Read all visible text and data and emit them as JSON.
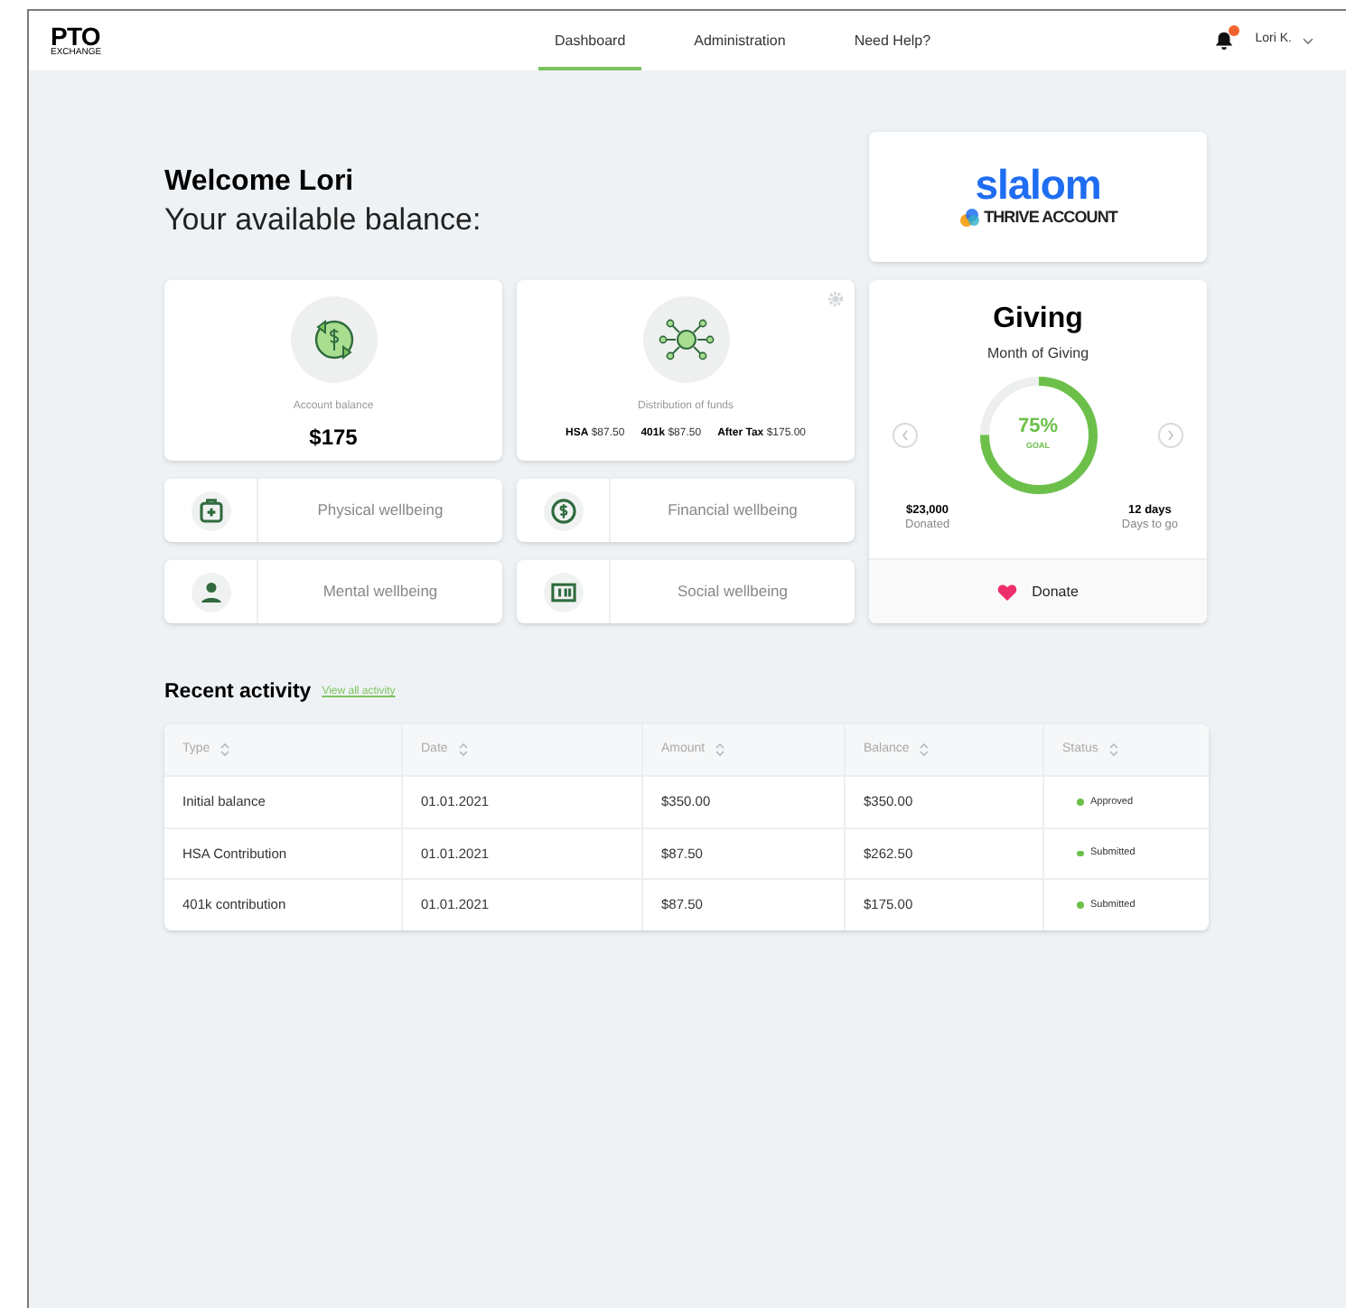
{
  "header": {
    "logo": {
      "title": "PTO",
      "subtitle": "EXCHANGE"
    },
    "nav": [
      {
        "label": "Dashboard",
        "selected": true
      },
      {
        "label": "Administration",
        "selected": false
      },
      {
        "label": "Need Help?",
        "selected": false
      }
    ],
    "notifications": {
      "unread": true
    },
    "user": "Lori K."
  },
  "welcome": {
    "title": "Welcome Lori",
    "subtitle": "Your available balance:"
  },
  "brand": {
    "name": "slalom",
    "account": "THRIVE ACCOUNT"
  },
  "account_card": {
    "label": "Account balance",
    "value": "$175"
  },
  "distribution_card": {
    "label": "Distribution of funds",
    "items": [
      {
        "name": "HSA",
        "value": "$87.50"
      },
      {
        "name": "401k",
        "value": "$87.50"
      },
      {
        "name": "After Tax",
        "value": "$175.00"
      }
    ]
  },
  "wellbeing": [
    {
      "kind": "physical",
      "label": "Physical wellbeing"
    },
    {
      "kind": "financial",
      "label": "Financial wellbeing"
    },
    {
      "kind": "mental",
      "label": "Mental wellbeing"
    },
    {
      "kind": "social",
      "label": "Social wellbeing"
    }
  ],
  "giving": {
    "title": "Giving",
    "subtitle": "Month of Giving",
    "level": 0.75,
    "percent": "75%",
    "goal_label": "GOAL",
    "donated": "$23,000",
    "donated_label": "Donated",
    "days": "12 days",
    "days_label": "Days to go",
    "donate_button": "Donate"
  },
  "recent_activity": {
    "title": "Recent activity",
    "link": "View all activity",
    "columns": [
      "Type",
      "Date",
      "Amount",
      "Balance",
      "Status"
    ],
    "rows": [
      {
        "type": "Initial balance",
        "date": "01.01.2021",
        "amount": "$350.00",
        "balance": "$350.00",
        "status": "Approved"
      },
      {
        "type": "HSA Contribution",
        "date": "01.01.2021",
        "amount": "$87.50",
        "balance": "$262.50",
        "status": "Submitted"
      },
      {
        "type": "401k contribution",
        "date": "01.01.2021",
        "amount": "$87.50",
        "balance": "$175.00",
        "status": "Submitted"
      }
    ]
  }
}
